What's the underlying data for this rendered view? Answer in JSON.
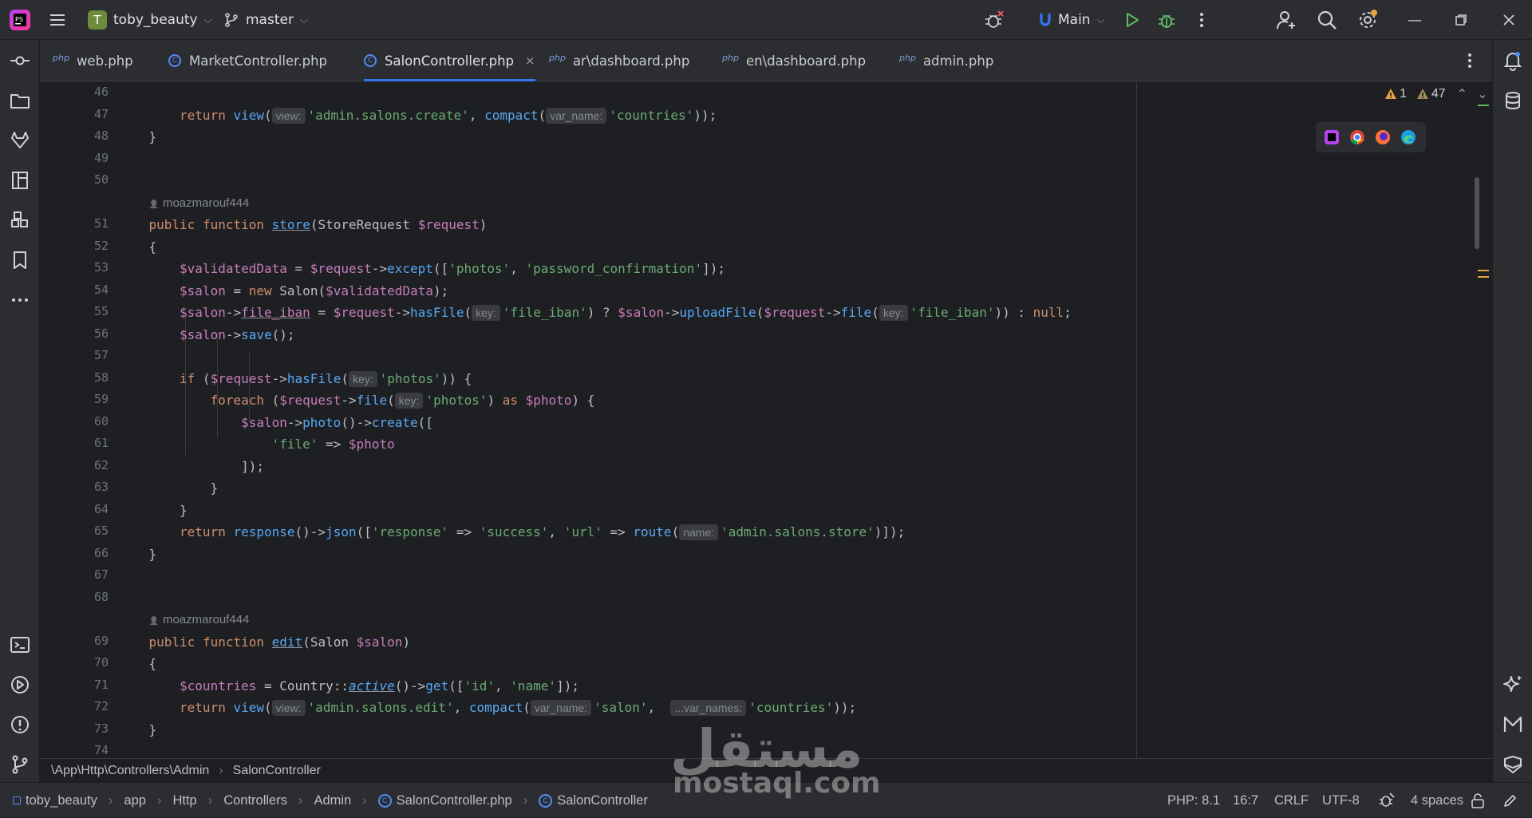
{
  "titlebar": {
    "project_initial": "T",
    "project_name": "toby_beauty",
    "branch": "master",
    "run_config": "Main"
  },
  "tabs": [
    {
      "label": "web.php",
      "type": "php"
    },
    {
      "label": "MarketController.php",
      "type": "class"
    },
    {
      "label": "SalonController.php",
      "type": "class",
      "active": true
    },
    {
      "label": "ar\\dashboard.php",
      "type": "php"
    },
    {
      "label": "en\\dashboard.php",
      "type": "php"
    },
    {
      "label": "admin.php",
      "type": "php"
    }
  ],
  "tab_php_tag": "php",
  "tab_close_glyph": "×",
  "problems": {
    "warnings": "1",
    "weak_warnings": "47"
  },
  "editor": {
    "line_numbers": [
      "46",
      "47",
      "48",
      "49",
      "50",
      "51",
      "52",
      "53",
      "54",
      "55",
      "56",
      "57",
      "58",
      "59",
      "60",
      "61",
      "62",
      "63",
      "64",
      "65",
      "66",
      "67",
      "68",
      "69",
      "70",
      "71",
      "72",
      "73",
      "74"
    ],
    "author_1": "moazmarouf444",
    "author_2": "moazmarouf444",
    "code": {
      "l47": {
        "kw": "return",
        "fn": "view",
        "hint_view": "view:",
        "s1": "'admin.salons.create'",
        "fn2": "compact",
        "hint_var": "var_name:",
        "s2": "'countries'"
      },
      "l48": "}",
      "l51": {
        "kw": "public function",
        "fn": "store",
        "cls": "StoreRequest",
        "var": "$request"
      },
      "l52": "{",
      "l53": {
        "var": "$validatedData",
        "var2": "$request",
        "fn": "except",
        "s1": "'photos'",
        "s2": "'password_confirmation'"
      },
      "l54": {
        "var": "$salon",
        "kw": "new",
        "cls": "Salon",
        "var2": "$validatedData"
      },
      "l55": {
        "var": "$salon",
        "prop": "file_iban",
        "var2": "$request",
        "fn": "hasFile",
        "hint": "key:",
        "s1": "'file_iban'",
        "var3": "$salon",
        "fn2": "uploadFile",
        "var4": "$request",
        "fn3": "file",
        "hint2": "key:",
        "s2": "'file_iban'",
        "kw": "null"
      },
      "l56": {
        "var": "$salon",
        "fn": "save"
      },
      "l58": {
        "kw": "if",
        "var": "$request",
        "fn": "hasFile",
        "hint": "key:",
        "s1": "'photos'"
      },
      "l59": {
        "kw": "foreach",
        "var": "$request",
        "fn": "file",
        "hint": "key:",
        "s1": "'photos'",
        "kw2": "as",
        "var2": "$photo"
      },
      "l60": {
        "var": "$salon",
        "fn": "photo",
        "fn2": "create"
      },
      "l61": {
        "s1": "'file'",
        "var": "$photo"
      },
      "l62": "]);",
      "l63": "}",
      "l64": "}",
      "l65": {
        "kw": "return",
        "fn": "response",
        "fn2": "json",
        "s1": "'response'",
        "s2": "'success'",
        "s3": "'url'",
        "fn3": "route",
        "hint": "name:",
        "s4": "'admin.salons.store'"
      },
      "l66": "}",
      "l69": {
        "kw": "public function",
        "fn": "edit",
        "cls": "Salon",
        "var": "$salon"
      },
      "l70": "{",
      "l71": {
        "var": "$countries",
        "cls": "Country",
        "fn": "active",
        "fn2": "get",
        "s1": "'id'",
        "s2": "'name'"
      },
      "l72": {
        "kw": "return",
        "fn": "view",
        "hint_view": "view:",
        "s1": "'admin.salons.edit'",
        "fn2": "compact",
        "hint_var": "var_name:",
        "s2": "'salon'",
        "hint_vars": "...var_names:",
        "s3": "'countries'"
      },
      "l73": "}"
    }
  },
  "breadcrumb": {
    "path": "\\App\\Http\\Controllers\\Admin",
    "class": "SalonController"
  },
  "statusbar": {
    "crumbs": [
      "toby_beauty",
      "app",
      "Http",
      "Controllers",
      "Admin",
      "SalonController.php",
      "SalonController"
    ],
    "php_version": "PHP: 8.1",
    "position": "16:7",
    "line_sep": "CRLF",
    "encoding": "UTF-8",
    "indent": "4 spaces"
  },
  "watermark": {
    "arabic": "مستقل",
    "latin": "mostaql.com"
  },
  "colors": {
    "accent": "#3574f0",
    "keyword": "#cf8e6d",
    "function": "#56a8f5",
    "variable": "#c77dbb",
    "string": "#6aab73"
  }
}
